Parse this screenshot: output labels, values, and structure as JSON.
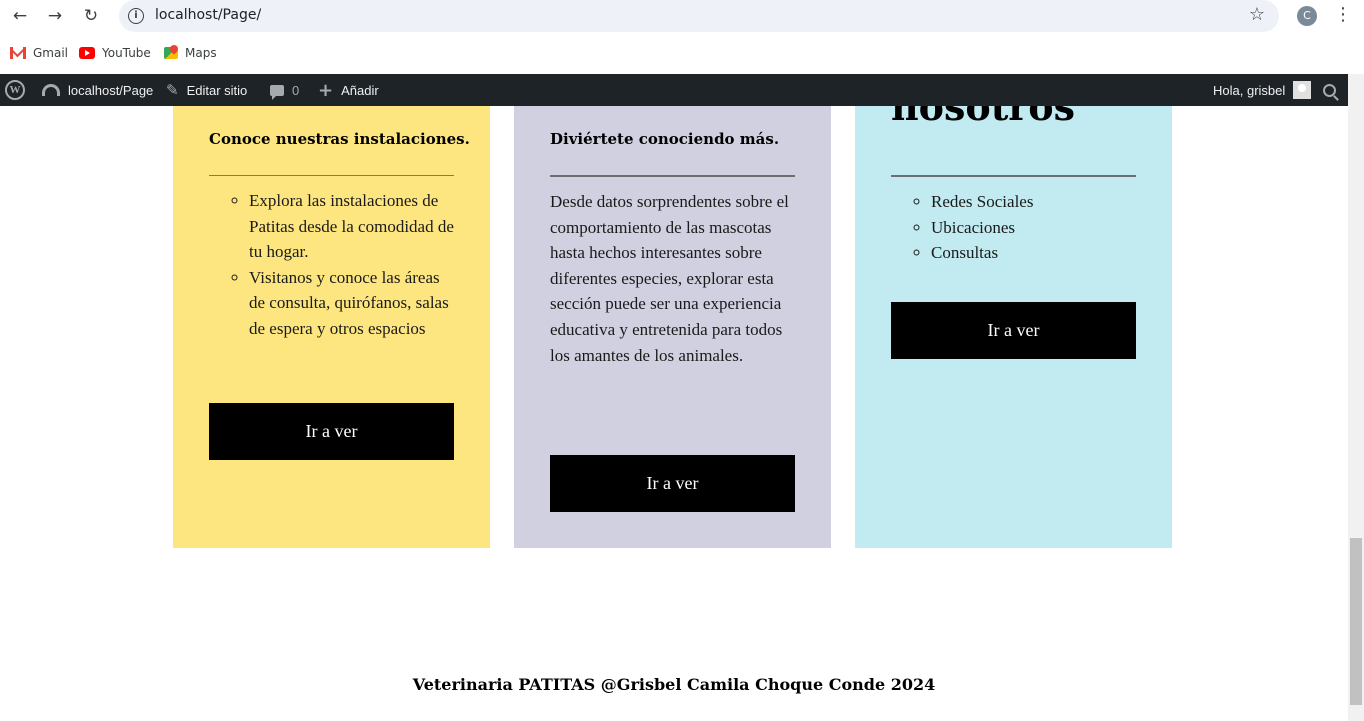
{
  "browser": {
    "url": "localhost/Page/",
    "profile_initial": "C",
    "bookmarks": [
      {
        "label": "Gmail",
        "icon": "gmail-icon"
      },
      {
        "label": "YouTube",
        "icon": "youtube-icon"
      },
      {
        "label": "Maps",
        "icon": "maps-icon"
      }
    ]
  },
  "adminbar": {
    "site": "localhost/Page",
    "edit": "Editar sitio",
    "comments": "0",
    "add": "Añadir",
    "greeting": "Hola, grisbel"
  },
  "cards": {
    "first": {
      "heading": "Conoce nuestras instalaciones.",
      "items": [
        "Explora las instalaciones de Patitas desde la comodidad de tu hogar.",
        "Visitanos y conoce las áreas de consulta, quirófanos, salas de espera y otros espacios"
      ],
      "button": "Ir a ver",
      "color": "#fde67f"
    },
    "second": {
      "heading": "Diviértete conociendo más.",
      "body": "Desde datos sorprendentes sobre el comportamiento de las mascotas hasta hechos interesantes sobre diferentes especies, explorar esta sección puede ser una experiencia educativa y entretenida para todos los amantes de los animales.",
      "button": "Ir a ver",
      "color": "#d1d0e0"
    },
    "third": {
      "heading": "nosotros",
      "items": [
        "Redes Sociales",
        "Ubicaciones",
        "Consultas"
      ],
      "button": "Ir a ver",
      "color": "#c1eaf1"
    }
  },
  "footer": {
    "text": "Veterinaria PATITAS @Grisbel Camila Choque Conde 2024"
  }
}
